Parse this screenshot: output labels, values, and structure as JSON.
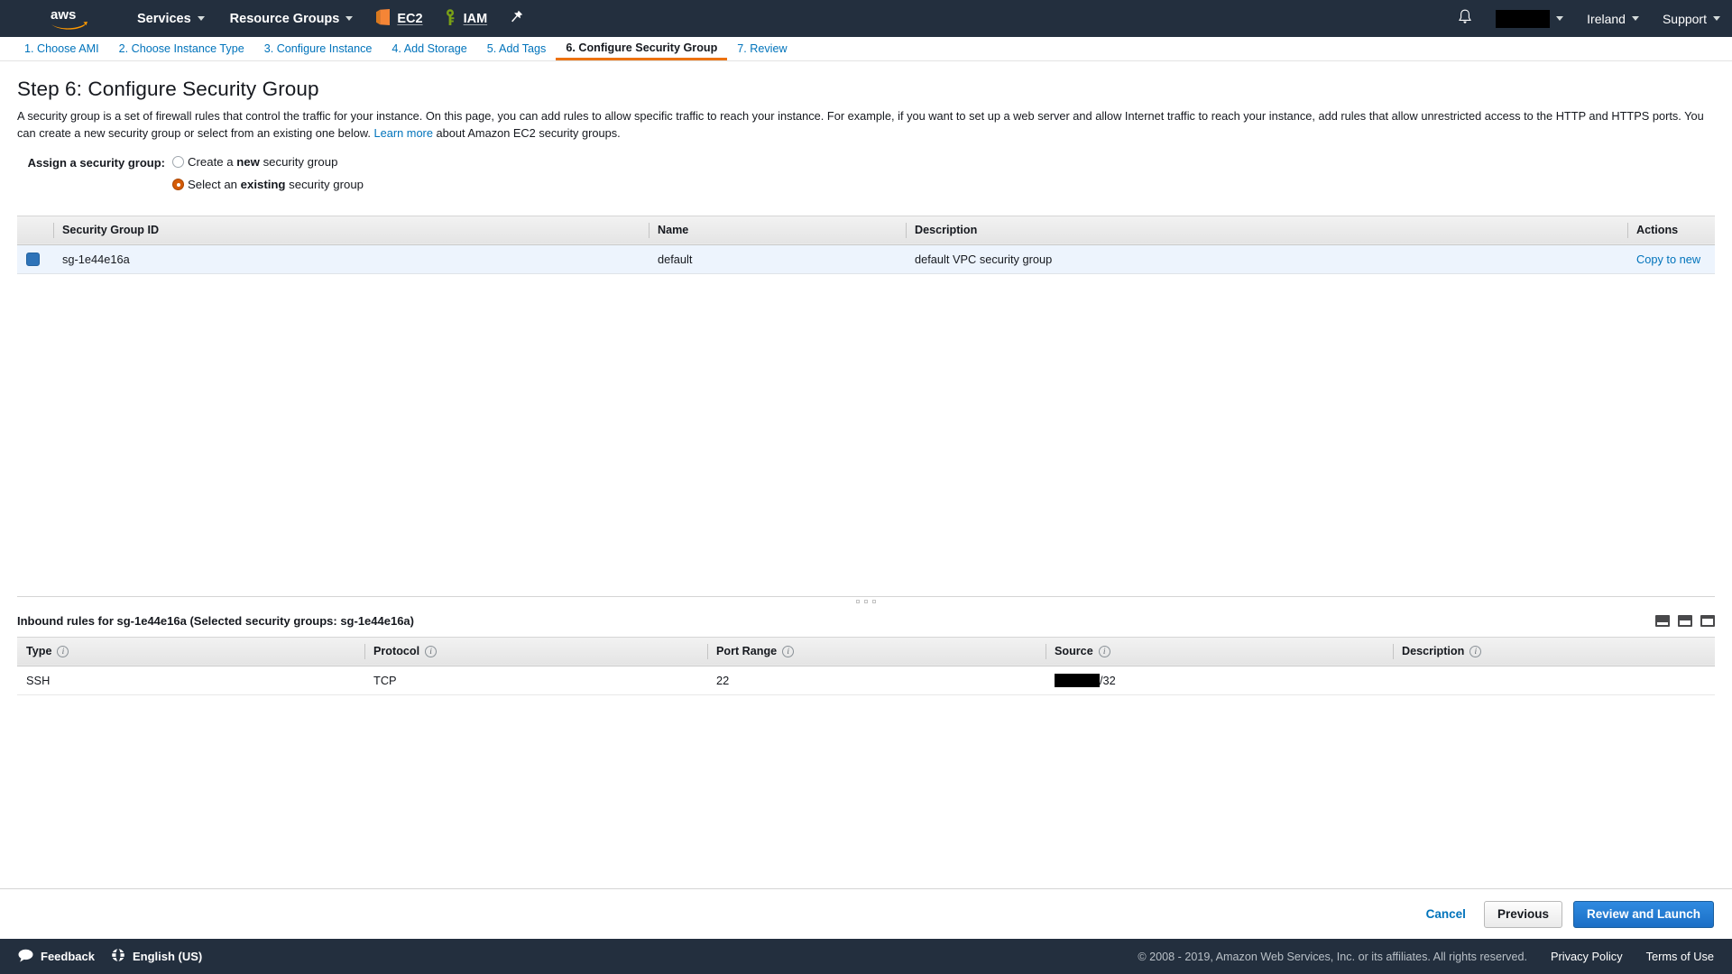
{
  "topnav": {
    "logo_icon": "aws-logo",
    "services_label": "Services",
    "resource_groups_label": "Resource Groups",
    "shortcuts": [
      {
        "label": "EC2",
        "icon": "ec2-icon"
      },
      {
        "label": "IAM",
        "icon": "iam-key-icon"
      }
    ],
    "pin_icon": "pushpin-icon",
    "bell_icon": "notification-bell-icon",
    "account_label": "",
    "account_redacted": true,
    "region_label": "Ireland",
    "support_label": "Support"
  },
  "wizard": {
    "tabs": [
      {
        "label": "1. Choose AMI",
        "active": false
      },
      {
        "label": "2. Choose Instance Type",
        "active": false
      },
      {
        "label": "3. Configure Instance",
        "active": false
      },
      {
        "label": "4. Add Storage",
        "active": false
      },
      {
        "label": "5. Add Tags",
        "active": false
      },
      {
        "label": "6. Configure Security Group",
        "active": true
      },
      {
        "label": "7. Review",
        "active": false
      }
    ]
  },
  "page": {
    "title": "Step 6: Configure Security Group",
    "description_part1": "A security group is a set of firewall rules that control the traffic for your instance. On this page, you can add rules to allow specific traffic to reach your instance. For example, if you want to set up a web server and allow Internet traffic to reach your instance, add rules that allow unrestricted access to the HTTP and HTTPS ports. You can create a new security group or select from an existing one below. ",
    "learn_more_label": "Learn more",
    "description_part2": " about Amazon EC2 security groups."
  },
  "assign": {
    "label": "Assign a security group:",
    "options": [
      {
        "prefix": "Create a ",
        "strong": "new",
        "suffix": " security group",
        "checked": false
      },
      {
        "prefix": "Select an ",
        "strong": "existing",
        "suffix": " security group",
        "checked": true
      }
    ]
  },
  "sg_table": {
    "columns": [
      "Security Group ID",
      "Name",
      "Description",
      "Actions"
    ],
    "rows": [
      {
        "selected": true,
        "id": "sg-1e44e16a",
        "name": "default",
        "description": "default VPC security group",
        "action_label": "Copy to new"
      }
    ]
  },
  "inbound": {
    "title": "Inbound rules for sg-1e44e16a (Selected security groups: sg-1e44e16a)",
    "layout_icons": [
      "layout-split-bottom-icon",
      "layout-split-even-icon",
      "layout-split-top-icon"
    ],
    "columns": [
      "Type",
      "Protocol",
      "Port Range",
      "Source",
      "Description"
    ],
    "rows": [
      {
        "type": "SSH",
        "protocol": "TCP",
        "port_range": "22",
        "source_redacted": true,
        "source_suffix": "/32",
        "description": ""
      }
    ]
  },
  "footer": {
    "cancel_label": "Cancel",
    "previous_label": "Previous",
    "review_label": "Review and Launch"
  },
  "statusbar": {
    "feedback_label": "Feedback",
    "feedback_icon": "speech-bubble-icon",
    "language_label": "English (US)",
    "language_icon": "globe-icon",
    "copyright": "© 2008 - 2019, Amazon Web Services, Inc. or its affiliates. All rights reserved.",
    "privacy_label": "Privacy Policy",
    "terms_label": "Terms of Use"
  },
  "colors": {
    "nav_background": "#232f3e",
    "accent_orange": "#ec7211",
    "link_blue": "#0073bb",
    "primary_button": "#1b6fc6",
    "radio_selected": "#d45b07"
  }
}
